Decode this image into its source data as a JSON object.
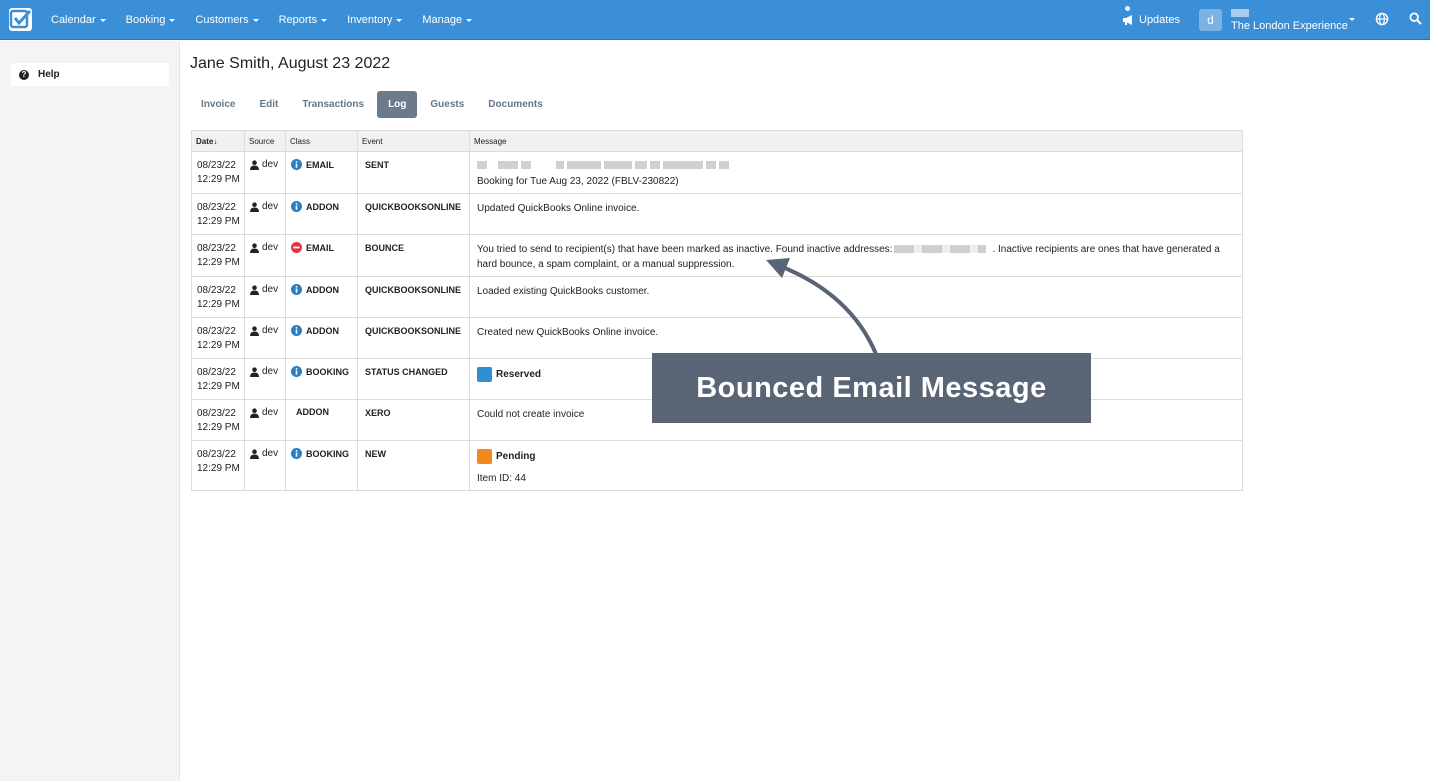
{
  "topbar": {
    "nav": [
      {
        "label": "Calendar"
      },
      {
        "label": "Booking"
      },
      {
        "label": "Customers"
      },
      {
        "label": "Reports"
      },
      {
        "label": "Inventory"
      },
      {
        "label": "Manage"
      }
    ],
    "updates_label": "Updates",
    "avatar_letter": "d",
    "account_name": "The London Experience"
  },
  "sidebar": {
    "help_label": "Help"
  },
  "page": {
    "title": "Jane Smith, August 23 2022",
    "tabs": [
      {
        "label": "Invoice"
      },
      {
        "label": "Edit"
      },
      {
        "label": "Transactions"
      },
      {
        "label": "Log",
        "active": true
      },
      {
        "label": "Guests"
      },
      {
        "label": "Documents"
      }
    ]
  },
  "table": {
    "headers": {
      "date": "Date",
      "source": "Source",
      "class": "Class",
      "event": "Event",
      "message": "Message"
    },
    "rows": [
      {
        "date": "08/23/22",
        "time": "12:29 PM",
        "source": "dev",
        "class": "EMAIL",
        "class_icon": "info-icon",
        "event": "SENT",
        "message": "Booking for Tue Aug 23, 2022 (FBLV-230822)"
      },
      {
        "date": "08/23/22",
        "time": "12:29 PM",
        "source": "dev",
        "class": "ADDON",
        "class_icon": "info-icon",
        "event": "QUICKBOOKSONLINE",
        "message": "Updated QuickBooks Online invoice."
      },
      {
        "date": "08/23/22",
        "time": "12:29 PM",
        "source": "dev",
        "class": "EMAIL",
        "class_icon": "error-icon",
        "event": "BOUNCE",
        "message_a": "You tried to send to recipient(s) that have been marked as inactive. Found inactive addresses:",
        "message_b": ". Inactive recipients are ones that have generated a hard bounce, a spam complaint, or a manual suppression."
      },
      {
        "date": "08/23/22",
        "time": "12:29 PM",
        "source": "dev",
        "class": "ADDON",
        "class_icon": "info-icon",
        "event": "QUICKBOOKSONLINE",
        "message": "Loaded existing QuickBooks customer."
      },
      {
        "date": "08/23/22",
        "time": "12:29 PM",
        "source": "dev",
        "class": "ADDON",
        "class_icon": "info-icon",
        "event": "QUICKBOOKSONLINE",
        "message": "Created new QuickBooks Online invoice."
      },
      {
        "date": "08/23/22",
        "time": "12:29 PM",
        "source": "dev",
        "class": "BOOKING",
        "class_icon": "info-icon",
        "event": "STATUS CHANGED",
        "status": "Reserved",
        "status_color": "#2f8fd0"
      },
      {
        "date": "08/23/22",
        "time": "12:29 PM",
        "source": "dev",
        "class": "ADDON",
        "event": "XERO",
        "message": "Could not create invoice"
      },
      {
        "date": "08/23/22",
        "time": "12:29 PM",
        "source": "dev",
        "class": "BOOKING",
        "class_icon": "info-icon",
        "event": "NEW",
        "status": "Pending",
        "status_color": "#f0891e",
        "message": "Item ID: 44"
      }
    ]
  },
  "callout": {
    "text": "Bounced Email Message",
    "color": "#596474"
  },
  "colors": {
    "topbar": "#3b8fd6",
    "info": "#2a7fc1",
    "error": "#d9363e",
    "active_tab": "#6c7b8a"
  }
}
